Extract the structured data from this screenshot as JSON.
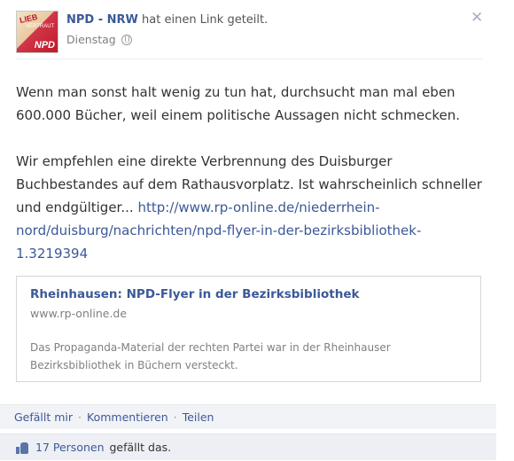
{
  "post": {
    "author": "NPD - NRW",
    "action": "hat einen Link geteilt.",
    "time": "Dienstag",
    "privacy_icon": "globe-icon",
    "close_icon": "close-icon",
    "close_glyph": "✕",
    "paragraph1": "Wenn man sonst halt wenig zu tun hat, durchsucht man mal eben 600.000 Bücher, weil einem politische Aussagen nicht schmecken.",
    "paragraph2": "Wir empfehlen eine direkte Verbrennung des Duisburger Buchbestandes auf dem Rathausvorplatz. Ist wahrscheinlich schneller und endgültiger...",
    "url": "http://www.rp-online.de/niederrhein-nord/duisburg/nachrichten/npd-flyer-in-der-bezirksbibliothek-1.3219394"
  },
  "link_preview": {
    "title": "Rheinhausen: NPD-Flyer in der Bezirksbibliothek",
    "domain": "www.rp-online.de",
    "description": "Das Propaganda-Material der rechten Partei war in der Rheinhauser Bezirksbibliothek in Büchern versteckt."
  },
  "actions": {
    "like": "Gefällt mir",
    "comment": "Kommentieren",
    "share": "Teilen",
    "separator": "·"
  },
  "likes": {
    "count": "17 Personen",
    "suffix": "gefällt das.",
    "icon": "thumbs-up-icon"
  },
  "colors": {
    "link": "#3b5998",
    "muted": "#7f7f7f",
    "footer_bg": "#edeff4"
  }
}
